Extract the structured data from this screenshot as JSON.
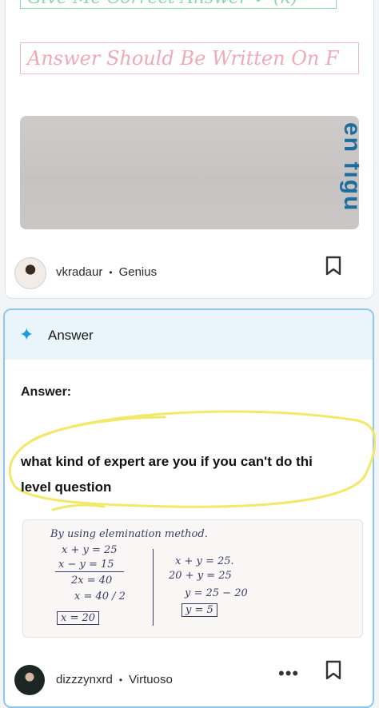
{
  "top_card": {
    "stamp_1": "Give Me Correct Answer ✔ (k)",
    "stamp_2": "Answer Should Be Written On F",
    "image_text": "en figu",
    "author": {
      "name": "vkradaur",
      "rank": "Genius"
    }
  },
  "answer_card": {
    "header_title": "Answer",
    "label": "Answer:",
    "text_line_1": "what kind of expert are you if you can't do thi",
    "text_line_2": "level question",
    "handwriting": {
      "heading": "By using elemination method.",
      "left_col": [
        "x + y = 25",
        "x − y = 15",
        "2x = 40",
        "x = 40 / 2",
        "x = 20"
      ],
      "right_col": [
        "x + y = 25.",
        "20 + y = 25",
        "y = 25 − 20",
        "y = 5"
      ]
    },
    "author": {
      "name": "dizzzynxrd",
      "rank": "Virtuoso"
    },
    "more_label": "•••"
  },
  "colors": {
    "accent": "#1e9be6",
    "circle": "#f2e86a",
    "stamp_green": "#8fd9a8",
    "stamp_pink": "#f0a9b7"
  }
}
